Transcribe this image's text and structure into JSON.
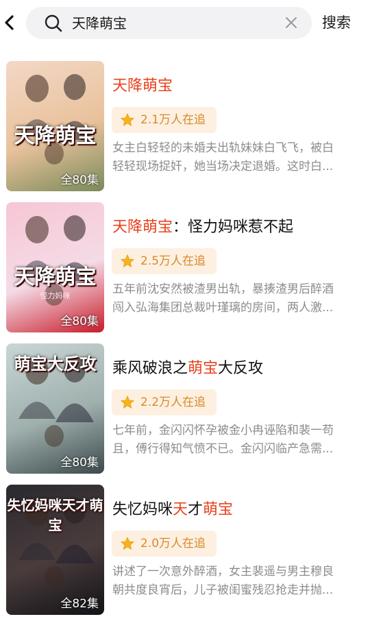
{
  "search": {
    "query": "天降萌宝",
    "button_label": "搜索"
  },
  "results": [
    {
      "title_parts": [
        {
          "t": "天降萌宝",
          "hl": true
        }
      ],
      "popularity": "2.1万人在追",
      "desc_lines": [
        "女主白轻轻的未婚夫出轨妹妹白飞飞，被白",
        "轻轻现场捉奸，她当场决定退婚。这时白..."
      ],
      "episodes": "全80集",
      "cover_title": "天降萌宝",
      "cover_colors": [
        "#f3d8c6",
        "#e9c29c",
        "#7a8a5a"
      ]
    },
    {
      "title_parts": [
        {
          "t": "天降萌宝",
          "hl": true
        },
        {
          "t": "：怪力妈咪惹不起",
          "hl": false
        }
      ],
      "popularity": "2.5万人在追",
      "desc_lines": [
        "五年前沈安然被渣男出轨，暴揍渣男后醉酒",
        "闯入弘海集团总裁叶瑾璃的房间，两人激..."
      ],
      "episodes": "全80集",
      "cover_title": "天降萌宝",
      "cover_subtitle": "怪力妈咪",
      "cover_colors": [
        "#f7c6d4",
        "#f4dbe6",
        "#c81b2a"
      ]
    },
    {
      "title_parts": [
        {
          "t": "乘风破浪之",
          "hl": false
        },
        {
          "t": "萌宝",
          "hl": true
        },
        {
          "t": "大反攻",
          "hl": false
        }
      ],
      "popularity": "2.2万人在追",
      "desc_lines": [
        "七年前，金闪闪怀孕被金小冉诬陷和裴一苟",
        "且，傅行得知气愤不已。金闪闪临产急需..."
      ],
      "episodes": "全80集",
      "cover_title": "萌宝大反攻",
      "cover_colors": [
        "#c9d6d6",
        "#9fb0ad",
        "#3d4a4c"
      ]
    },
    {
      "title_parts": [
        {
          "t": "失忆妈咪",
          "hl": false
        },
        {
          "t": "天",
          "hl": true
        },
        {
          "t": "才",
          "hl": false
        },
        {
          "t": "萌宝",
          "hl": true
        }
      ],
      "popularity": "2.0万人在追",
      "desc_lines": [
        "讲述了一次意外醉酒，女主裴遥与男主穆良",
        "朝共度良宵后，儿子被闺蜜残忍抢走并抛..."
      ],
      "episodes": "全82集",
      "cover_title": "失忆妈咪天才萌宝",
      "cover_colors": [
        "#2a2a30",
        "#4a3c3c",
        "#121216"
      ]
    }
  ]
}
